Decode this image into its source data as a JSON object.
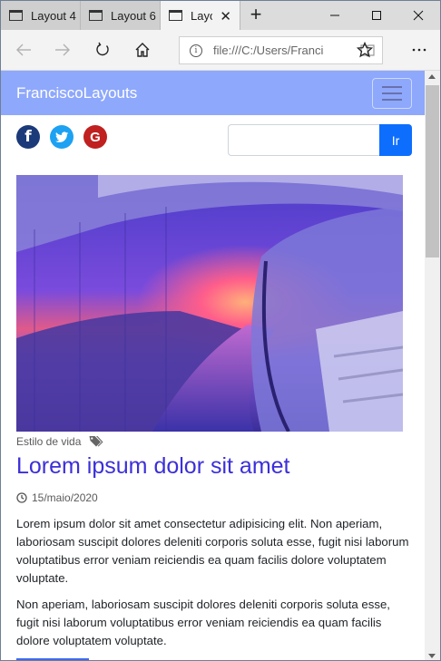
{
  "browser": {
    "tabs": [
      {
        "title": "Layout 4"
      },
      {
        "title": "Layout 6"
      },
      {
        "title": "Layout"
      }
    ],
    "address": "file:///C:/Users/Francisco/Desktop",
    "window_controls": [
      "minimize",
      "maximize",
      "close"
    ],
    "nav_icons": [
      "back-arrow-icon",
      "forward-arrow-icon",
      "refresh-icon",
      "home-icon",
      "reading-view-icon",
      "favorite-star-icon",
      "more-icon"
    ]
  },
  "site": {
    "brand": "FranciscoLayouts",
    "social": [
      {
        "name": "facebook",
        "glyph": "f",
        "color": "#1b3a7a"
      },
      {
        "name": "twitter",
        "glyph": "t",
        "color": "#1da1f2"
      },
      {
        "name": "google",
        "glyph": "G",
        "color": "#c0201f"
      }
    ],
    "search": {
      "value": "",
      "button_label": "Ir"
    }
  },
  "post": {
    "category": "Estilo de vida",
    "title": "Lorem ipsum dolor sit amet",
    "date": "15/maio/2020",
    "paragraphs": [
      "Lorem ipsum dolor sit amet consectetur adipisicing elit. Non aperiam, laboriosam suscipit dolores deleniti corporis soluta esse, fugit nisi laborum voluptatibus error veniam reiciendis ea quam facilis dolore voluptatem voluptate.",
      "Non aperiam, laboriosam suscipit dolores deleniti corporis soluta esse, fugit nisi laborum voluptatibus error veniam reiciendis ea quam facilis dolore voluptatem voluptate."
    ]
  },
  "colors": {
    "navbar": "#8ea8fb",
    "title": "#3b2fd9",
    "button": "#0d6efd"
  }
}
